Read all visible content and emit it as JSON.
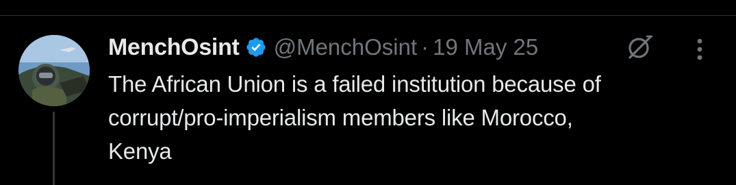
{
  "tweet": {
    "author": {
      "display_name": "MenchOsint",
      "handle": "@MenchOsint",
      "verified": true,
      "avatar_icon": "pilot-cockpit-avatar"
    },
    "separator": "·",
    "date": "19 May 25",
    "text_lines": [
      "The African Union is a failed institution because of",
      "corrupt/pro-imperialism members like Morocco,",
      "Kenya"
    ]
  },
  "colors": {
    "background": "#000000",
    "primary_text": "#e7e9ea",
    "secondary_text": "#71767b",
    "verified_blue": "#1d9bf0",
    "divider": "#2f3336"
  },
  "icons": {
    "verified": "verified-badge-icon",
    "grok": "grok-icon",
    "more": "more-options-icon"
  }
}
